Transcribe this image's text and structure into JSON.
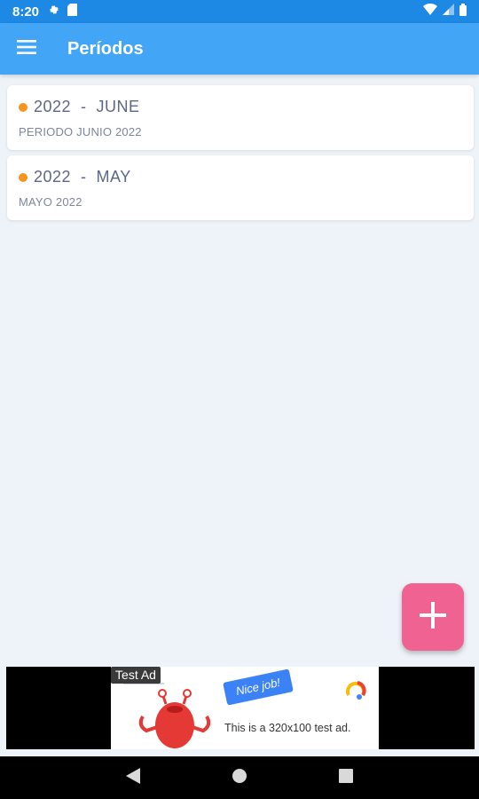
{
  "status_bar": {
    "time": "8:20"
  },
  "app_bar": {
    "title": "Períodos"
  },
  "periods": [
    {
      "title": "2022  -  JUNE",
      "subtitle": "PERIODO JUNIO 2022"
    },
    {
      "title": "2022  -  MAY",
      "subtitle": "MAYO 2022"
    }
  ],
  "ad": {
    "label": "Test Ad",
    "tagline": "Nice job!",
    "text": "This is a 320x100 test ad."
  },
  "colors": {
    "status_bar": "#1e88e5",
    "app_bar": "#42a5f5",
    "dot": "#f7941d",
    "fab": "#f06292",
    "background": "#eef3f9"
  },
  "icons": {
    "menu": "menu-icon",
    "add": "plus-icon",
    "back": "back-triangle-icon",
    "home": "home-circle-icon",
    "recents": "recents-square-icon"
  }
}
